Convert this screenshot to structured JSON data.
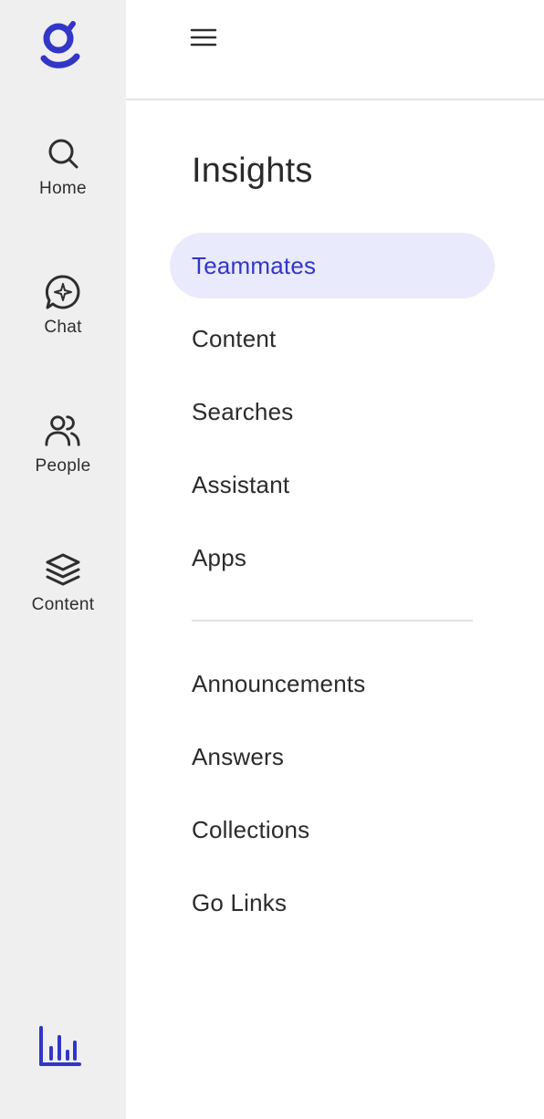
{
  "colors": {
    "rail_bg": "#efefef",
    "accent": "#3236c8",
    "active_bg": "#e9eafb",
    "text": "#2b2b2b"
  },
  "rail": {
    "logo_icon": "glean-logo-icon",
    "items": [
      {
        "label": "Home",
        "icon": "search-icon"
      },
      {
        "label": "Chat",
        "icon": "chat-sparkle-icon"
      },
      {
        "label": "People",
        "icon": "people-icon"
      },
      {
        "label": "Content",
        "icon": "layers-icon"
      }
    ],
    "bottom_icon": "bar-chart-icon"
  },
  "header": {
    "menu_icon": "hamburger-menu-icon"
  },
  "insights": {
    "title": "Insights",
    "primary_items": [
      {
        "label": "Teammates",
        "active": true
      },
      {
        "label": "Content",
        "active": false
      },
      {
        "label": "Searches",
        "active": false
      },
      {
        "label": "Assistant",
        "active": false
      },
      {
        "label": "Apps",
        "active": false
      }
    ],
    "secondary_items": [
      {
        "label": "Announcements"
      },
      {
        "label": "Answers"
      },
      {
        "label": "Collections"
      },
      {
        "label": "Go Links"
      }
    ]
  }
}
